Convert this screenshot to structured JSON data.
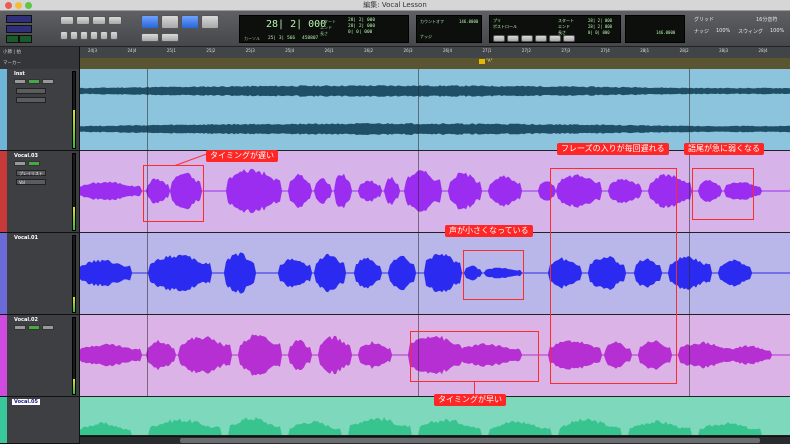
{
  "window": {
    "title": "編集: Vocal Lesson"
  },
  "toolbar": {
    "counter_main": "28| 2| 000",
    "start_label": "スタート",
    "end_label": "エンド",
    "length_label": "長さ",
    "start_value": "28| 2| 000",
    "end_value": "28| 2| 000",
    "length_value": "0| 0| 000",
    "cursor_label": "カーソル",
    "cursor_value": "25| 3| 566",
    "sample_value": "458807",
    "grid_label": "グリッド",
    "grid_value": "16分音符",
    "nudge_label": "ナッジ",
    "swing_label": "スウィング",
    "zoom_value": "100%",
    "swing_value": "100%",
    "tempo_value": "146.0000",
    "meter_value": "80",
    "pre_label": "プリ",
    "post_label": "ポストロール",
    "countoff_label": "カウントオフ"
  },
  "ruler": {
    "bars_label": "小節 | 拍",
    "markers_label": "マーカー",
    "bar_numbers": [
      "24|3",
      "24|4",
      "25|1",
      "25|2",
      "25|3",
      "25|4",
      "26|1",
      "26|2",
      "26|3",
      "26|4",
      "27|1",
      "27|2",
      "27|3",
      "27|4",
      "28|1",
      "28|2",
      "28|3",
      "28|4"
    ],
    "marker_text": "\"A\""
  },
  "tracks": [
    {
      "name": "Inst",
      "color": "#6fb5d8",
      "waveform": "#1f4f66",
      "lane_bg": "#8cc4de"
    },
    {
      "name": "Vocal.03",
      "color": "#c04aff",
      "waveform": "#9a2df0",
      "lane_bg": "#d6b4ea",
      "playlist_label": "プレイリスト",
      "vol_label": "Vol"
    },
    {
      "name": "Vocal.01",
      "color": "#6a6ad8",
      "waveform": "#2a2af0",
      "lane_bg": "#b9b6e9"
    },
    {
      "name": "Vocal.02",
      "color": "#d04ae0",
      "waveform": "#b62fd2",
      "lane_bg": "#dcb3e6"
    },
    {
      "name": "Vocal.05",
      "color": "#3ac79a",
      "waveform": "#38c48e",
      "lane_bg": "#7ed8bb"
    }
  ],
  "annotations": [
    {
      "text": "タイミングが遅い"
    },
    {
      "text": "フレーズの入りが毎回遅れる"
    },
    {
      "text": "語尾が急に弱くなる"
    },
    {
      "text": "声が小さくなっている"
    },
    {
      "text": "タイミングが早い"
    }
  ],
  "colors": {
    "annotation": "#ff2626",
    "counter_text": "#b9f5b1"
  }
}
